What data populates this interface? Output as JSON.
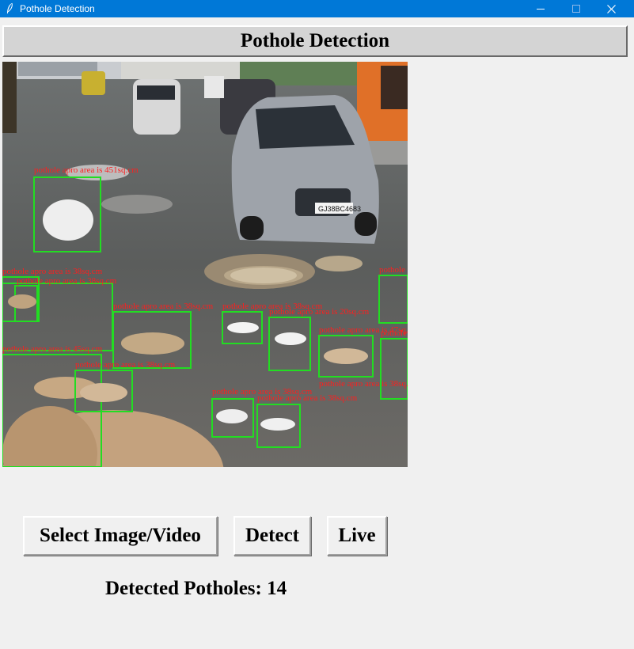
{
  "window": {
    "title": "Pothole Detection"
  },
  "header": {
    "title": "Pothole Detection"
  },
  "image": {
    "plate_text": "GJ38BC4683",
    "detections": [
      {
        "label": "pothole apro area is 451sq.cm"
      },
      {
        "label": "pothole apro area is 38sq.cm"
      },
      {
        "label": "pothole apro area is 38sq.cm"
      },
      {
        "label": "pothole apro area is 38sq.cm"
      },
      {
        "label": "pothole apro area is 45sq.cm"
      },
      {
        "label": "pothole apro area is 38sq.cm"
      },
      {
        "label": "pothole apro area is 20sq.cm"
      },
      {
        "label": "pothole apro area is 47sq.cm"
      },
      {
        "label": "pothole apro area is 38sq.cm"
      },
      {
        "label": "pothole apro area is 38sq.cm"
      },
      {
        "label": "pothole apro area is 38sq.cm"
      },
      {
        "label": "pothole apro area is 38sq.cm"
      },
      {
        "label": "pothole apro area is 38sq.cm"
      },
      {
        "label": "pothole apro area is 38sq.cm"
      }
    ]
  },
  "buttons": {
    "select_label": "Select Image/Video",
    "detect_label": "Detect",
    "live_label": "Live"
  },
  "status": {
    "detected_text": "Detected Potholes: 14"
  },
  "colors": {
    "titlebar": "#0078d7",
    "box": "#22dd22",
    "label": "#ff1e1e"
  }
}
